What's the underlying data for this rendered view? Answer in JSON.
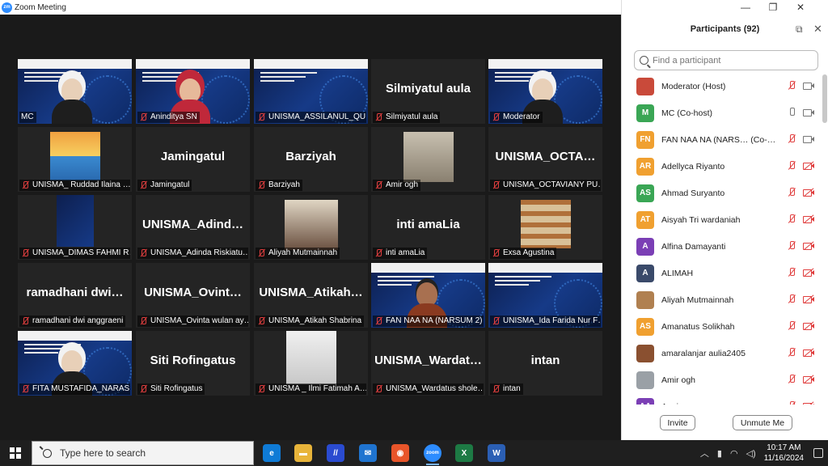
{
  "window": {
    "title": "Zoom Meeting",
    "app_logo": "zm"
  },
  "panel": {
    "title": "Participants (92)",
    "search_placeholder": "Find a participant",
    "invite_label": "Invite",
    "unmute_label": "Unmute Me",
    "participants": [
      {
        "name": "Moderator (Host)",
        "initials": "",
        "color": "#c94a3a",
        "mic": "off",
        "cam": "on"
      },
      {
        "name": "MC (Co-host)",
        "initials": "M",
        "color": "#3aa655",
        "mic": "on",
        "cam": "on"
      },
      {
        "name": "FAN NAA NA (NARS… (Co-host)",
        "initials": "FN",
        "color": "#f0a030",
        "mic": "off",
        "cam": "on"
      },
      {
        "name": "Adellyca Riyanto",
        "initials": "AR",
        "color": "#f0a030",
        "mic": "off",
        "cam": "off"
      },
      {
        "name": "Ahmad Suryanto",
        "initials": "AS",
        "color": "#3aa655",
        "mic": "off",
        "cam": "off"
      },
      {
        "name": "Aisyah Tri wardaniah",
        "initials": "AT",
        "color": "#f0a030",
        "mic": "off",
        "cam": "off"
      },
      {
        "name": "Alfina Damayanti",
        "initials": "A",
        "color": "#7b3fb5",
        "mic": "off",
        "cam": "off"
      },
      {
        "name": "ALIMAH",
        "initials": "A",
        "color": "#3a4a6a",
        "mic": "off",
        "cam": "off"
      },
      {
        "name": "Aliyah Mutmainnah",
        "initials": "",
        "color": "#b08050",
        "mic": "off",
        "cam": "off"
      },
      {
        "name": "Amanatus Solikhah",
        "initials": "AS",
        "color": "#f0a030",
        "mic": "off",
        "cam": "off"
      },
      {
        "name": "amaralanjar aulia2405",
        "initials": "",
        "color": "#8a5030",
        "mic": "off",
        "cam": "off"
      },
      {
        "name": "Amir ogh",
        "initials": "",
        "color": "#9aa0a6",
        "mic": "off",
        "cam": "off"
      },
      {
        "name": "Anni…",
        "initials": "AA",
        "color": "#7b3fb5",
        "mic": "off",
        "cam": "off"
      }
    ]
  },
  "tiles": [
    {
      "label": "MC",
      "big": "",
      "type": "slide-person",
      "active": true,
      "mic_off": false
    },
    {
      "label": "Aninditya SN",
      "big": "",
      "type": "slide-person2",
      "active": false,
      "mic_off": true
    },
    {
      "label": "UNISMA_ASSILANUL_QU…",
      "big": "",
      "type": "slide",
      "active": false,
      "mic_off": true
    },
    {
      "label": "Silmiyatul aula",
      "big": "Silmiyatul aula",
      "type": "name",
      "active": false,
      "mic_off": true
    },
    {
      "label": "Moderator",
      "big": "",
      "type": "slide-person",
      "active": false,
      "mic_off": true
    },
    {
      "label": "UNISMA_ Ruddad Ilaina …",
      "big": "",
      "type": "sunset",
      "active": false,
      "mic_off": true
    },
    {
      "label": "Jamingatul",
      "big": "Jamingatul",
      "type": "name",
      "active": false,
      "mic_off": true
    },
    {
      "label": "Barziyah",
      "big": "Barziyah",
      "type": "name",
      "active": false,
      "mic_off": true
    },
    {
      "label": "Amir ogh",
      "big": "",
      "type": "room",
      "active": false,
      "mic_off": true
    },
    {
      "label": "UNISMA_OCTAVIANY PU…",
      "big": "UNISMA_OCTA…",
      "type": "name",
      "active": false,
      "mic_off": true
    },
    {
      "label": "UNISMA_DIMAS FAHMI R…",
      "big": "",
      "type": "smallslide",
      "active": false,
      "mic_off": true
    },
    {
      "label": "UNISMA_Adinda Riskiatu…",
      "big": "UNISMA_Adind…",
      "type": "name",
      "active": false,
      "mic_off": true
    },
    {
      "label": "Aliyah Mutmainnah",
      "big": "",
      "type": "cafe",
      "active": false,
      "mic_off": true
    },
    {
      "label": "inti amaLia",
      "big": "inti amaLia",
      "type": "name",
      "active": false,
      "mic_off": true
    },
    {
      "label": "Exsa Agustina",
      "big": "",
      "type": "bookshelf",
      "active": false,
      "mic_off": true
    },
    {
      "label": "ramadhani dwi anggraeni",
      "big": "ramadhani dwi…",
      "type": "name",
      "active": false,
      "mic_off": true
    },
    {
      "label": "UNISMA_Ovinta wulan ay…",
      "big": "UNISMA_Ovint…",
      "type": "name",
      "active": false,
      "mic_off": true
    },
    {
      "label": "UNISMA_Atikah Shabrina",
      "big": "UNISMA_Atikah…",
      "type": "name",
      "active": false,
      "mic_off": true
    },
    {
      "label": "FAN NAA NA (NARSUM 2)",
      "big": "",
      "type": "slide-man",
      "active": false,
      "mic_off": true
    },
    {
      "label": "UNISMA_Ida Farida Nur F…",
      "big": "",
      "type": "slide",
      "active": false,
      "mic_off": true
    },
    {
      "label": "FITA MUSTAFIDA_NARAS…",
      "big": "",
      "type": "slide-person3",
      "active": false,
      "mic_off": true
    },
    {
      "label": "Siti Rofingatus",
      "big": "Siti Rofingatus",
      "type": "name",
      "active": false,
      "mic_off": true
    },
    {
      "label": "UNISMA _ Ilmi Fatimah A…",
      "big": "",
      "type": "wall",
      "active": false,
      "mic_off": true
    },
    {
      "label": "UNISMA_Wardatus shole…",
      "big": "UNISMA_Wardat…",
      "type": "name",
      "active": false,
      "mic_off": true
    },
    {
      "label": "intan",
      "big": "intan",
      "type": "name",
      "active": false,
      "mic_off": true
    }
  ],
  "taskbar": {
    "search_placeholder": "Type here to search",
    "time": "10:17 AM",
    "date": "11/16/2024",
    "apps": [
      {
        "name": "edge-icon",
        "color": "#0f7bd6",
        "glyph": "e"
      },
      {
        "name": "file-explorer-icon",
        "color": "#e8b43a",
        "glyph": "▬"
      },
      {
        "name": "slash-app-icon",
        "color": "#2a4bd0",
        "glyph": "//"
      },
      {
        "name": "mail-icon",
        "color": "#1f74d0",
        "glyph": "✉"
      },
      {
        "name": "firefox-icon",
        "color": "#e8552a",
        "glyph": "◉"
      },
      {
        "name": "zoom-icon",
        "color": "#2d8cff",
        "glyph": "zoom"
      },
      {
        "name": "excel-icon",
        "color": "#1d7a44",
        "glyph": "X"
      },
      {
        "name": "word-icon",
        "color": "#2b5fb4",
        "glyph": "W"
      }
    ]
  }
}
